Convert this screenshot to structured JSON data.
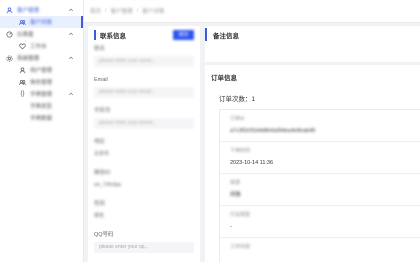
{
  "sidebar": {
    "groups": [
      {
        "label": "客户管理",
        "icon": "person-icon",
        "active": true,
        "items": [
          {
            "label": "客户列表",
            "icon": "group-icon",
            "active": true
          }
        ]
      },
      {
        "label": "仪表盘",
        "icon": "dashboard-icon",
        "items": [
          {
            "label": "工作台",
            "icon": "heart-icon"
          }
        ]
      },
      {
        "label": "系统管理",
        "icon": "settings-icon",
        "items": [
          {
            "label": "用户管理",
            "icon": "user-icon"
          },
          {
            "label": "角色管理",
            "icon": "users-icon"
          },
          {
            "label": "字典管理",
            "icon": "braces-icon",
            "children": [
              {
                "label": "字典类型"
              },
              {
                "label": "字典数据"
              }
            ]
          }
        ]
      }
    ]
  },
  "breadcrumb": {
    "items": [
      "首页",
      "客户管理",
      "客户详情"
    ]
  },
  "contact": {
    "title": "联系信息",
    "save_label": "保存",
    "fields": {
      "name": {
        "label": "姓名",
        "placeholder": "please enter your name..."
      },
      "email": {
        "label": "Email",
        "placeholder": "please enter your email..."
      },
      "phone": {
        "label": "手机号",
        "placeholder": "please enter your phone..."
      },
      "region": {
        "label": "地区",
        "value": "北京市"
      },
      "wechat": {
        "label": "微信ID",
        "value": "wx_7r8x3pq"
      },
      "gender": {
        "label": "性别",
        "value": "男性"
      },
      "qq": {
        "label": "QQ号码",
        "placeholder": "please enter your qq..."
      }
    }
  },
  "notes": {
    "title": "备注信息"
  },
  "orders": {
    "title": "订单信息",
    "count_label": "订单次数：1",
    "order": {
      "id_label": "订单id",
      "id_value": "a7c3f2e91b4d8e6a5fdea4e8eab46",
      "time_label": "下单时间",
      "time_value": "2023-10-14 11:36",
      "source_label": "来源",
      "source_value": "闲鱼",
      "industry_label": "行业类型",
      "industry_value": "-",
      "content_label": "工作内容"
    }
  },
  "colors": {
    "accent": "#2f54eb",
    "active_bg": "#e8efff"
  }
}
